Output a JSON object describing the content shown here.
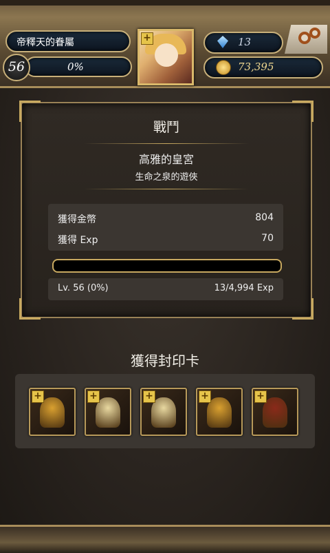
{
  "player": {
    "title": "帝釋天的眷屬",
    "level": "56",
    "exp_percent": "0%",
    "gems": "13",
    "gold": "73,395"
  },
  "battle": {
    "heading": "戰鬥",
    "stage_name": "高雅的皇宮",
    "sub_stage": "生命之泉的遊俠",
    "rewards": [
      {
        "label": "獲得金幣",
        "value": "804"
      },
      {
        "label": "獲得 Exp",
        "value": "70"
      }
    ],
    "exp_bar_fraction": 0.0,
    "level_label": "Lv. 56 (0%)",
    "exp_progress": "13/4,994 Exp"
  },
  "cards_section": {
    "heading": "獲得封印卡",
    "cards": [
      {
        "icon": "golden-dragon-knight-card",
        "color": "#d9a030"
      },
      {
        "icon": "angel-maiden-card",
        "color": "#e8d8a0"
      },
      {
        "icon": "angel-maiden-card",
        "color": "#e8d8a0"
      },
      {
        "icon": "golden-dragon-knight-card",
        "color": "#d9a030"
      },
      {
        "icon": "red-armored-knight-card",
        "color": "#8a2a1a"
      }
    ]
  },
  "icons": {
    "plus": "+"
  }
}
